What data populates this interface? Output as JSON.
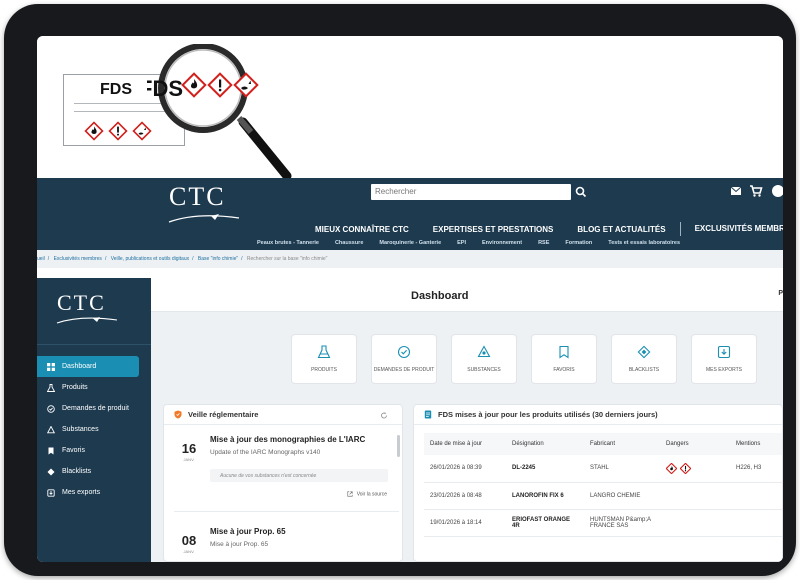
{
  "hero": {
    "fds_label": "FDS"
  },
  "site": {
    "logo": "CTC",
    "search_placeholder": "Rechercher",
    "nav": [
      "MIEUX CONNAÎTRE CTC",
      "EXPERTISES ET PRESTATIONS",
      "BLOG ET ACTUALITÉS",
      "EXCLUSIVITÉS MEMBRES"
    ],
    "subnav": [
      "Peaux brutes - Tannerie",
      "Chaussure",
      "Maroquinerie - Ganterie",
      "EPI",
      "Environnement",
      "RSE",
      "Formation",
      "Tests et essais laboratoires"
    ],
    "breadcrumb": [
      "ueil",
      "Exclusivités membres",
      "Veille, publications et outils digitaux",
      "Base \"info chimie\""
    ],
    "breadcrumb_current": "Rechercher sur la base \"info chimie\""
  },
  "app": {
    "logo": "CTC",
    "page_title": "Dashboard",
    "topbar_right": "P",
    "sidebar": [
      {
        "label": "Dashboard",
        "icon": "grid-icon",
        "active": true
      },
      {
        "label": "Produits",
        "icon": "flask-icon"
      },
      {
        "label": "Demandes de produit",
        "icon": "request-icon"
      },
      {
        "label": "Substances",
        "icon": "substance-icon"
      },
      {
        "label": "Favoris",
        "icon": "bookmark-icon"
      },
      {
        "label": "Blacklists",
        "icon": "blacklist-icon"
      },
      {
        "label": "Mes exports",
        "icon": "export-icon"
      }
    ],
    "tiles": [
      "PRODUITS",
      "DEMANDES DE PRODUIT",
      "SUBSTANCES",
      "FAVORIS",
      "BLACKLISTS",
      "MES EXPORTS"
    ],
    "veille": {
      "title": "Veille réglementaire",
      "items": [
        {
          "day": "16",
          "month": "JANV.",
          "title": "Mise à jour des monographies de L'IARC",
          "subtitle": "Update of the IARC Monographs v140",
          "note": "Aucune de vos substances n'est concernée",
          "link": "Voir la source"
        },
        {
          "day": "08",
          "month": "JANV.",
          "title": "Mise à jour Prop. 65",
          "subtitle": "Mise à jour Prop. 65"
        }
      ]
    },
    "fds": {
      "title": "FDS mises à jour pour les produits utilisés (30 derniers jours)",
      "columns": [
        "Date de mise à jour",
        "Désignation",
        "Fabricant",
        "Dangers",
        "Mentions"
      ],
      "rows": [
        {
          "date": "26/01/2026 à 08:39",
          "designation": "DL-2245",
          "fabricant": "STAHL",
          "mentions": "H226, H3"
        },
        {
          "date": "23/01/2026 à 08:48",
          "designation": "LANOROFIN FIX 6",
          "fabricant": "LANGRO CHEMIE",
          "mentions": ""
        },
        {
          "date": "19/01/2026 à 18:14",
          "designation": "ERIOFAST ORANGE 4R",
          "fabricant": "HUNTSMAN P&amp;A FRANCE SAS",
          "mentions": ""
        }
      ]
    }
  },
  "colors": {
    "navy": "#1d3a4f",
    "accent": "#1a8fb3",
    "hazard_red": "#d0201c"
  }
}
